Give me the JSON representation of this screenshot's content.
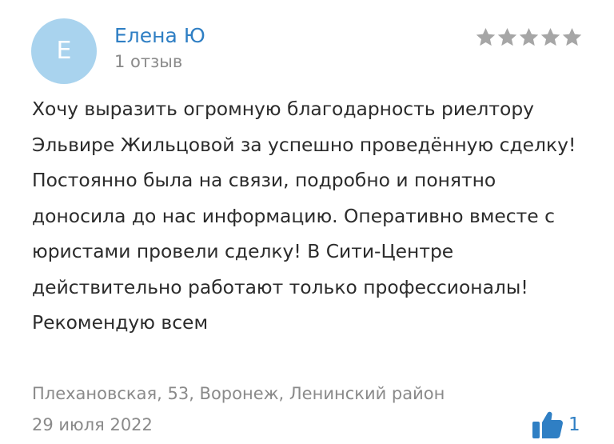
{
  "review": {
    "author_initial": "Е",
    "author_name": "Елена Ю",
    "review_count": "1 отзыв",
    "rating": 5,
    "text": "Хочу выразить огромную благодарность риелтору Эльвире Жильцовой за успешно проведённую сделку! Постоянно была на связи, подробно и понятно доносила до нас информацию. Оперативно вместе с юристами провели сделку! В Сити-Центре действительно работают только профессионалы! Рекомендую всем",
    "address": "Плехановская, 53, Воронеж, Ленинский район",
    "date": "29 июля 2022",
    "likes": "1"
  },
  "icons": {
    "star": "star-icon",
    "like": "thumbs-up-icon"
  },
  "colors": {
    "accent": "#2f7fc4",
    "avatar_bg": "#a9d3ee",
    "star": "#a6a6a6",
    "muted_text": "#8a8a8a",
    "body_text": "#2b2b2b"
  }
}
